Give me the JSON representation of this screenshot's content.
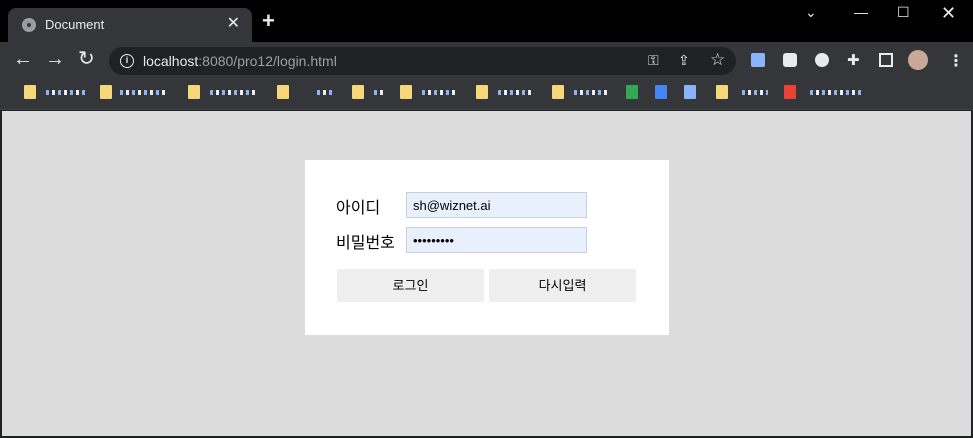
{
  "browser": {
    "tab_title": "Document",
    "tab_close": "✕",
    "new_tab": "+",
    "url_host": "localhost",
    "url_path": ":8080/pro12/login.html"
  },
  "login": {
    "id_label": "아이디",
    "pw_label": "비밀번호",
    "id_value": "sh@wiznet.ai",
    "pw_value": "•••••••••",
    "login_button": "로그인",
    "reset_button": "다시입력"
  }
}
